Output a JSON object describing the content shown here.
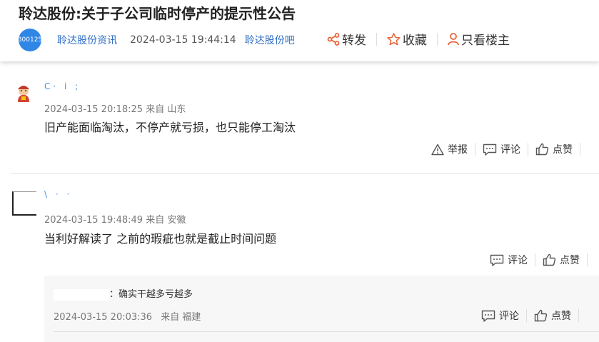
{
  "header": {
    "title": "聆达股份:关于子公司临时停产的提示性公告",
    "stock_code": "300125",
    "source": "聆达股份资讯",
    "timestamp": "2024-03-15 19:44:14",
    "bar_link": "聆达股份吧",
    "actions": {
      "share": "转发",
      "favorite": "收藏",
      "only_op": "只看楼主"
    },
    "accent_color": "#2f86e6"
  },
  "comments": [
    {
      "username": "C· i   ;",
      "time": "2024-03-15 20:18:25",
      "from_label": "来自",
      "location": "山东",
      "text": "旧产能面临淘汰，不停产就亏损，也只能停工淘汰",
      "actions": {
        "report": "举报",
        "comment": "评论",
        "like": "点赞"
      }
    },
    {
      "username": "\\    ·  ·",
      "time": "2024-03-15 19:48:49",
      "from_label": "来自",
      "location": "安徽",
      "text": "当利好解读了 之前的瑕疵也就是截止时间问题",
      "actions": {
        "comment": "评论",
        "like": "点赞"
      },
      "reply": {
        "suffix": "：确实干越多亏越多",
        "time": "2024-03-15 20:03:36",
        "from_label": "来自",
        "location": "福建",
        "actions": {
          "comment": "评论",
          "like": "点赞"
        }
      }
    }
  ]
}
